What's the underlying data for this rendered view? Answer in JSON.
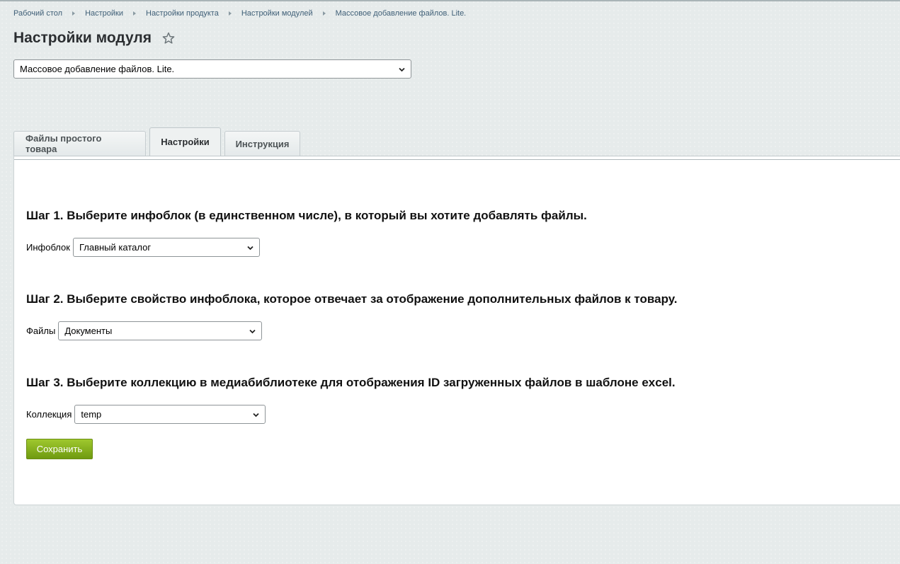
{
  "breadcrumb": [
    "Рабочий стол",
    "Настройки",
    "Настройки продукта",
    "Настройки модулей",
    "Массовое добавление файлов. Lite."
  ],
  "page_title": "Настройки модуля",
  "module_select": {
    "value": "Массовое добавление файлов. Lite."
  },
  "tabs": [
    {
      "label": "Файлы простого товара",
      "active": false
    },
    {
      "label": "Настройки",
      "active": true
    },
    {
      "label": "Инструкция",
      "active": false
    }
  ],
  "steps": [
    {
      "heading": "Шаг 1. Выберите инфоблок (в единственном числе), в который вы хотите добавлять файлы.",
      "label": "Инфоблок",
      "value": "Главный каталог"
    },
    {
      "heading": "Шаг 2. Выберите свойство инфоблока, которое отвечает за отображение дополнительных файлов к товару.",
      "label": "Файлы",
      "value": "Документы"
    },
    {
      "heading": "Шаг 3. Выберите коллекцию в медиабиблиотеке для отображения ID загруженных файлов в шаблоне excel.",
      "label": "Коллекция",
      "value": "temp"
    }
  ],
  "save_button": "Сохранить",
  "icons": {
    "favorite": "star-outline-icon",
    "dropdown": "chevron-down-icon"
  },
  "colors": {
    "save_button": "#86b21f",
    "breadcrumb_link": "#3f5f77",
    "background": "#e6ebeb"
  }
}
